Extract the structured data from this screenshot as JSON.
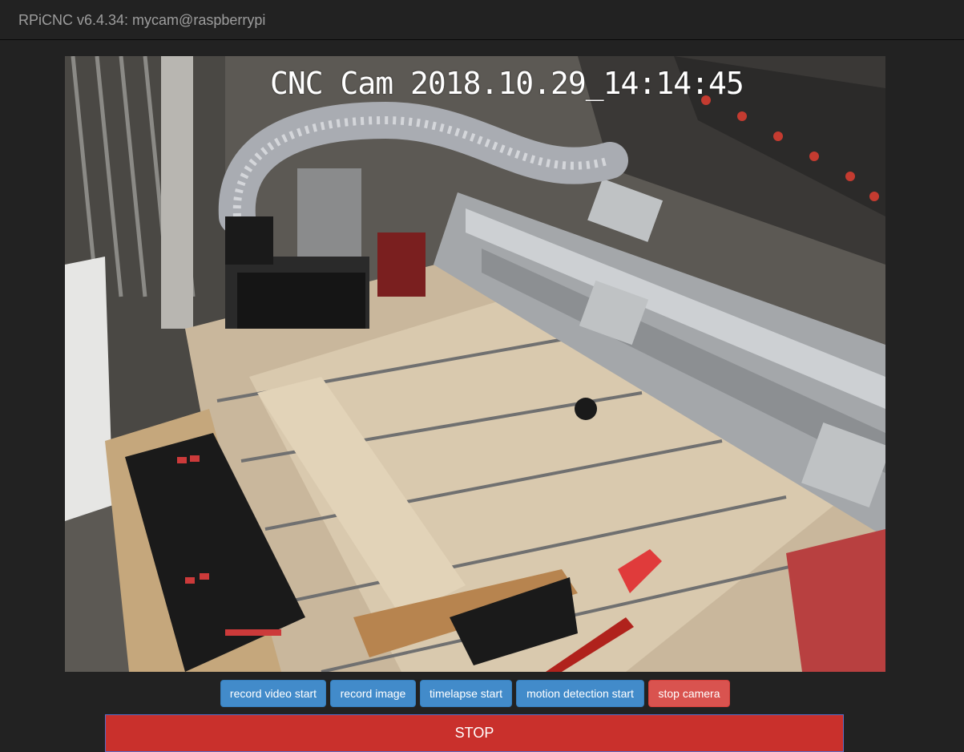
{
  "navbar": {
    "brand": "RPiCNC v6.4.34: mycam@raspberrypi"
  },
  "camera": {
    "overlay_text": "CNC Cam 2018.10.29_14:14:45"
  },
  "controls": {
    "record_video": "record video start",
    "record_image": "record image",
    "timelapse": "timelapse start",
    "motion_detection": "motion detection start",
    "stop_camera": "stop camera"
  },
  "stop_button": "STOP",
  "colors": {
    "background": "#222222",
    "brand_text": "#9d9d9d",
    "primary": "#428bca",
    "danger": "#d9534f",
    "stop": "#c9302c"
  }
}
